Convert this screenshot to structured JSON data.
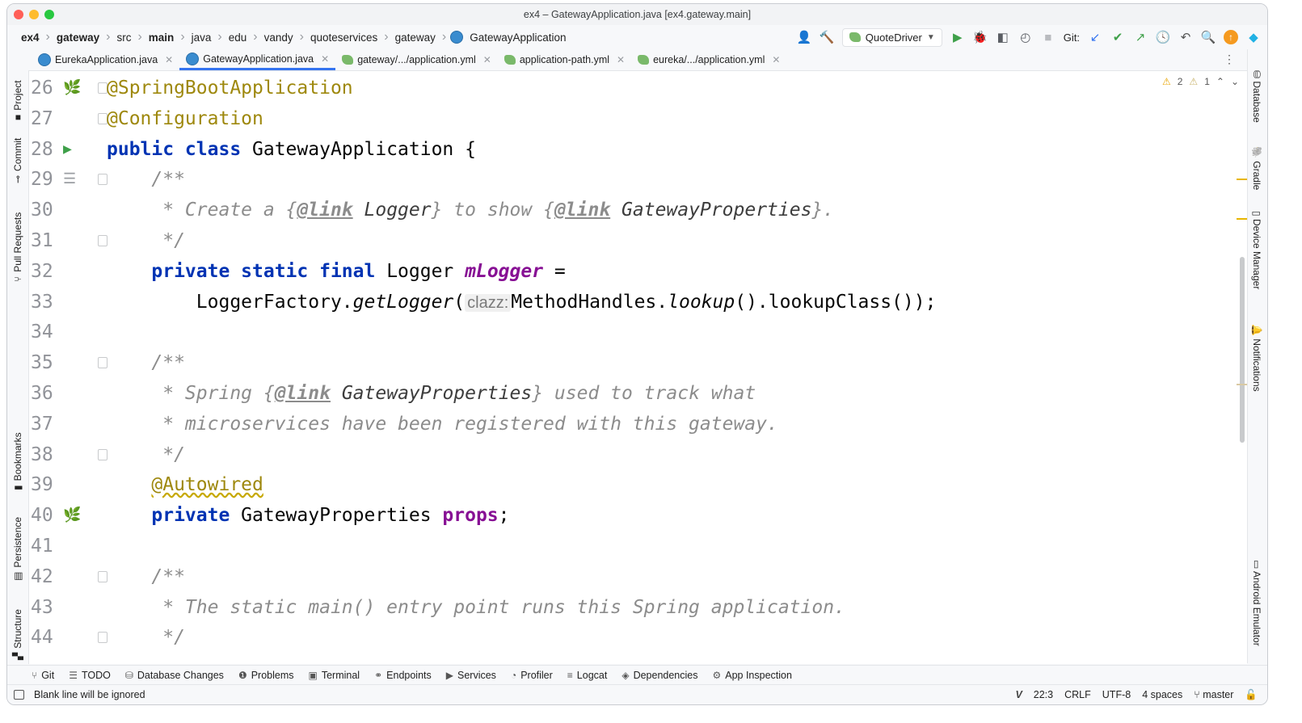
{
  "window": {
    "title": "ex4 – GatewayApplication.java [ex4.gateway.main]",
    "traffic_lights": [
      "#ff5f57",
      "#febc2e",
      "#28c840"
    ]
  },
  "breadcrumbs": [
    {
      "label": "ex4",
      "bold": true
    },
    {
      "label": "gateway",
      "bold": true
    },
    {
      "label": "src",
      "bold": false
    },
    {
      "label": "main",
      "bold": true
    },
    {
      "label": "java",
      "bold": false
    },
    {
      "label": "edu",
      "bold": false
    },
    {
      "label": "vandy",
      "bold": false
    },
    {
      "label": "quoteservices",
      "bold": false
    },
    {
      "label": "gateway",
      "bold": false
    },
    {
      "label": "GatewayApplication",
      "bold": false
    }
  ],
  "toolbar": {
    "run_config": "QuoteDriver",
    "git_label": "Git:"
  },
  "tabs": [
    {
      "label": "EurekaApplication.java",
      "icon": "java-class-icon",
      "active": false
    },
    {
      "label": "GatewayApplication.java",
      "icon": "java-class-icon",
      "active": true
    },
    {
      "label": "gateway/.../application.yml",
      "icon": "yml-icon",
      "active": false
    },
    {
      "label": "application-path.yml",
      "icon": "yml-icon",
      "active": false
    },
    {
      "label": "eureka/.../application.yml",
      "icon": "yml-icon",
      "active": false
    }
  ],
  "left_tools": {
    "project": "Project",
    "commit": "Commit",
    "pull_requests": "Pull Requests",
    "bookmarks": "Bookmarks",
    "persistence": "Persistence",
    "structure": "Structure"
  },
  "right_tools": {
    "database": "Database",
    "gradle": "Gradle",
    "device_manager": "Device Manager",
    "notifications": "Notifications",
    "android_emulator": "Android Emulator"
  },
  "inspections": {
    "warnings": "2",
    "weak_warnings": "1"
  },
  "code_lines": [
    {
      "n": "26",
      "gutter": "spring-bean-icon",
      "fold": true,
      "segs": [
        [
          "ann",
          "@SpringBootApplication"
        ]
      ]
    },
    {
      "n": "27",
      "gutter": "",
      "fold": true,
      "segs": [
        [
          "ann",
          "@Configuration"
        ]
      ]
    },
    {
      "n": "28",
      "gutter": "run-icon",
      "fold": false,
      "segs": [
        [
          "kw",
          "public class "
        ],
        [
          "",
          "GatewayApplication {"
        ]
      ]
    },
    {
      "n": "29",
      "gutter": "doc-icon",
      "fold": true,
      "segs": [
        [
          "",
          "    "
        ],
        [
          "cmt",
          "/**"
        ]
      ]
    },
    {
      "n": "30",
      "gutter": "",
      "fold": false,
      "segs": [
        [
          "cmt",
          "     * Create a {"
        ],
        [
          "tag",
          "@link"
        ],
        [
          "cmt",
          " "
        ],
        [
          "cref",
          "Logger"
        ],
        [
          "cmt",
          "} to show {"
        ],
        [
          "tag",
          "@link"
        ],
        [
          "cmt",
          " "
        ],
        [
          "cref",
          "GatewayProperties"
        ],
        [
          "cmt",
          "}."
        ]
      ]
    },
    {
      "n": "31",
      "gutter": "",
      "fold": true,
      "segs": [
        [
          "cmt",
          "     */"
        ]
      ]
    },
    {
      "n": "32",
      "gutter": "",
      "fold": false,
      "segs": [
        [
          "",
          "    "
        ],
        [
          "kw",
          "private static final "
        ],
        [
          "",
          "Logger "
        ],
        [
          "field",
          "mLogger"
        ],
        [
          "",
          " ="
        ]
      ]
    },
    {
      "n": "33",
      "gutter": "",
      "fold": false,
      "segs": [
        [
          "",
          "        LoggerFactory."
        ],
        [
          "meth",
          "getLogger"
        ],
        [
          "",
          "("
        ],
        [
          "hint",
          "clazz:"
        ],
        [
          "",
          "MethodHandles."
        ],
        [
          "meth",
          "lookup"
        ],
        [
          "",
          "().lookupClass());"
        ]
      ]
    },
    {
      "n": "34",
      "gutter": "",
      "fold": false,
      "segs": []
    },
    {
      "n": "35",
      "gutter": "",
      "fold": true,
      "segs": [
        [
          "",
          "    "
        ],
        [
          "cmt",
          "/**"
        ]
      ]
    },
    {
      "n": "36",
      "gutter": "",
      "fold": false,
      "segs": [
        [
          "cmt",
          "     * Spring {"
        ],
        [
          "tag",
          "@link"
        ],
        [
          "cmt",
          " "
        ],
        [
          "cref",
          "GatewayProperties"
        ],
        [
          "cmt",
          "} used to track what"
        ]
      ]
    },
    {
      "n": "37",
      "gutter": "",
      "fold": false,
      "segs": [
        [
          "cmt",
          "     * microservices have been registered with this gateway."
        ]
      ]
    },
    {
      "n": "38",
      "gutter": "",
      "fold": true,
      "segs": [
        [
          "cmt",
          "     */"
        ]
      ]
    },
    {
      "n": "39",
      "gutter": "",
      "fold": false,
      "segs": [
        [
          "",
          "    "
        ],
        [
          "ann wavy",
          "@Autowired"
        ]
      ]
    },
    {
      "n": "40",
      "gutter": "spring-autowire-icon",
      "fold": false,
      "segs": [
        [
          "",
          "    "
        ],
        [
          "kw",
          "private "
        ],
        [
          "",
          "GatewayProperties "
        ],
        [
          "fieldn",
          "props"
        ],
        [
          "",
          ";"
        ]
      ]
    },
    {
      "n": "41",
      "gutter": "",
      "fold": false,
      "segs": []
    },
    {
      "n": "42",
      "gutter": "",
      "fold": true,
      "segs": [
        [
          "",
          "    "
        ],
        [
          "cmt",
          "/**"
        ]
      ]
    },
    {
      "n": "43",
      "gutter": "",
      "fold": false,
      "segs": [
        [
          "cmt",
          "     * The static main() entry point runs this Spring application."
        ]
      ]
    },
    {
      "n": "44",
      "gutter": "",
      "fold": true,
      "segs": [
        [
          "cmt",
          "     */"
        ]
      ]
    }
  ],
  "bottom_tools": [
    {
      "label": "Git",
      "icon": "git-branch-icon",
      "glyph": "⑂"
    },
    {
      "label": "TODO",
      "icon": "list-icon",
      "glyph": "☰"
    },
    {
      "label": "Database Changes",
      "icon": "database-changes-icon",
      "glyph": "⛁"
    },
    {
      "label": "Problems",
      "icon": "problems-icon",
      "glyph": "❶"
    },
    {
      "label": "Terminal",
      "icon": "terminal-icon",
      "glyph": "▣"
    },
    {
      "label": "Endpoints",
      "icon": "endpoints-icon",
      "glyph": "⚭"
    },
    {
      "label": "Services",
      "icon": "services-icon",
      "glyph": "▶"
    },
    {
      "label": "Profiler",
      "icon": "profiler-icon",
      "glyph": "◔"
    },
    {
      "label": "Logcat",
      "icon": "logcat-icon",
      "glyph": "≡"
    },
    {
      "label": "Dependencies",
      "icon": "dependencies-icon",
      "glyph": "◈"
    },
    {
      "label": "App Inspection",
      "icon": "app-inspection-icon",
      "glyph": "⚙"
    }
  ],
  "status": {
    "message": "Blank line will be ignored",
    "position": "22:3",
    "line_ending": "CRLF",
    "encoding": "UTF-8",
    "indent": "4 spaces",
    "branch": "master"
  }
}
